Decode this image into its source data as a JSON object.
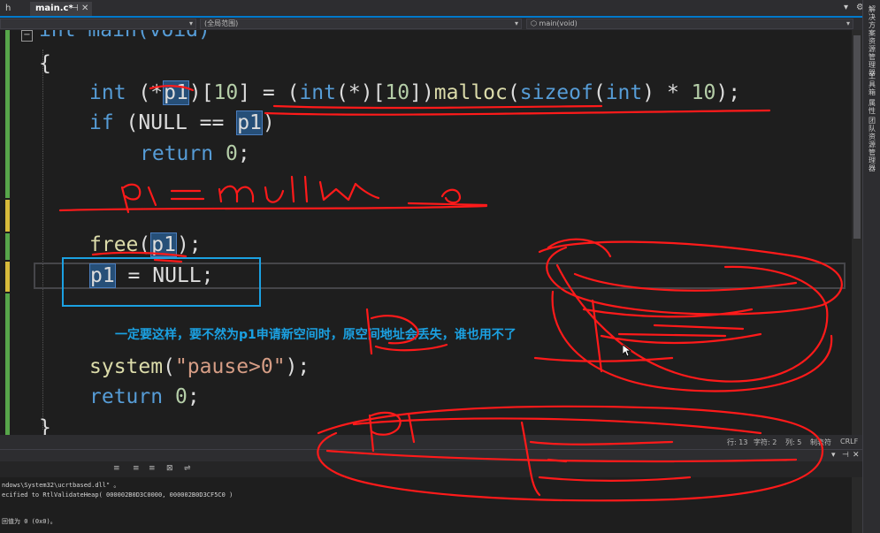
{
  "tabs": {
    "prev_label": "h",
    "active_label": "main.c*",
    "active_pin": "⊣",
    "active_close": "✕"
  },
  "navbar": {
    "scope_label": "(全局范围)",
    "function_label": "main(void)"
  },
  "editor": {
    "lines": {
      "l1": "int main(void)",
      "l2": "{",
      "l3_kw": "int",
      "l3_a": " (*",
      "l3_var": "p1",
      "l3_b": ")[",
      "l3_n1": "10",
      "l3_c": "] = (",
      "l3_kw2": "int",
      "l3_d": "(*)[",
      "l3_n2": "10",
      "l3_e": "])",
      "l3_fn": "malloc",
      "l3_f": "(",
      "l3_kw3": "sizeof",
      "l3_g": "(",
      "l3_kw4": "int",
      "l3_h": ") * ",
      "l3_n3": "10",
      "l3_i": ");",
      "l4_kw": "if",
      "l4_a": " (NULL == ",
      "l4_var": "p1",
      "l4_b": ")",
      "l5_kw": "return",
      "l5_a": " ",
      "l5_n": "0",
      "l5_b": ";",
      "l6_fn": "free",
      "l6_a": "(",
      "l6_var": "p1",
      "l6_b": ");",
      "l7_var": "p1",
      "l7_a": " = NULL;",
      "l8_fn": "system",
      "l8_a": "(",
      "l8_str": "\"pause>0\"",
      "l8_b": ");",
      "l9_kw": "return",
      "l9_a": " ",
      "l9_n": "0",
      "l9_b": ";",
      "l10": "}"
    },
    "annotation": "一定要这样，要不然为p1申请新空间时，原空间地址会丢失，谁也用不了",
    "fold_symbol": "−"
  },
  "statusbar": {
    "line": "行: 13",
    "char": "字符: 2",
    "col": "列: 5",
    "tab": "制表符",
    "eol": "CRLF"
  },
  "output": {
    "lines": [
      "ndows\\System32\\ucrtbased.dll\" 。",
      "ecified to RtlValidateHeap( 000002B0D3C0000, 000002B0D3CF5C0 )",
      "",
      "回值为 0 (0x0)。"
    ]
  },
  "sidepanel": {
    "labels": [
      "解决方案资源管理器",
      "工具箱",
      "属性",
      "团队资源管理器"
    ]
  },
  "colors": {
    "accent": "#007acc",
    "annotation_blue": "#1ba1e2",
    "ink_red": "#ff1a1a",
    "keyword": "#569cd6",
    "string": "#d69d85"
  }
}
